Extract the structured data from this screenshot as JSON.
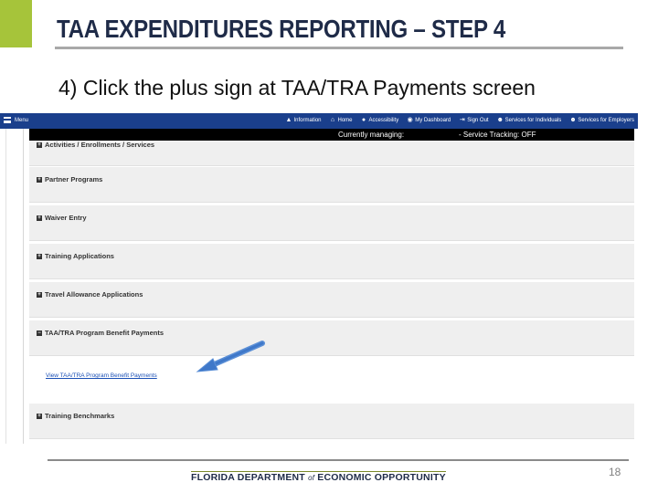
{
  "slide": {
    "title": "TAA EXPENDITURES REPORTING – STEP 4",
    "subtitle": "4) Click the plus sign at TAA/TRA Payments screen",
    "page_number": "18",
    "footer_logo_part1": "FLORIDA DEPARTMENT",
    "footer_logo_of": "of",
    "footer_logo_part2": "ECONOMIC OPPORTUNITY",
    "accent_color": "#a6c43a",
    "title_color": "#1f2b48"
  },
  "app": {
    "nav": {
      "menu_label": "Menu",
      "items": [
        {
          "label": "Information",
          "icon": "warning-icon"
        },
        {
          "label": "Home",
          "icon": "home-icon"
        },
        {
          "label": "Accessibility",
          "icon": "accessibility-icon"
        },
        {
          "label": "My Dashboard",
          "icon": "dashboard-icon"
        },
        {
          "label": "Sign Out",
          "icon": "sign-out-icon"
        },
        {
          "label": "Services for Individuals",
          "icon": "individuals-icon"
        },
        {
          "label": "Services for Employers",
          "icon": "employers-icon"
        }
      ],
      "color": "#1a3f8c"
    },
    "status": {
      "managing": "Currently managing:",
      "tracking": "- Service Tracking: OFF"
    },
    "sections": [
      {
        "label": "Activities / Enrollments / Services",
        "toggle": "+"
      },
      {
        "label": "Partner Programs",
        "toggle": "+"
      },
      {
        "label": "Waiver Entry",
        "toggle": "+"
      },
      {
        "label": "Training Applications",
        "toggle": "+"
      },
      {
        "label": "Travel Allowance Applications",
        "toggle": "+"
      },
      {
        "label": "TAA/TRA Program Benefit Payments",
        "toggle": "−"
      },
      {
        "label": "Training Benchmarks",
        "toggle": "+"
      }
    ],
    "expanded_link": "View TAA/TRA Program Benefit Payments"
  }
}
